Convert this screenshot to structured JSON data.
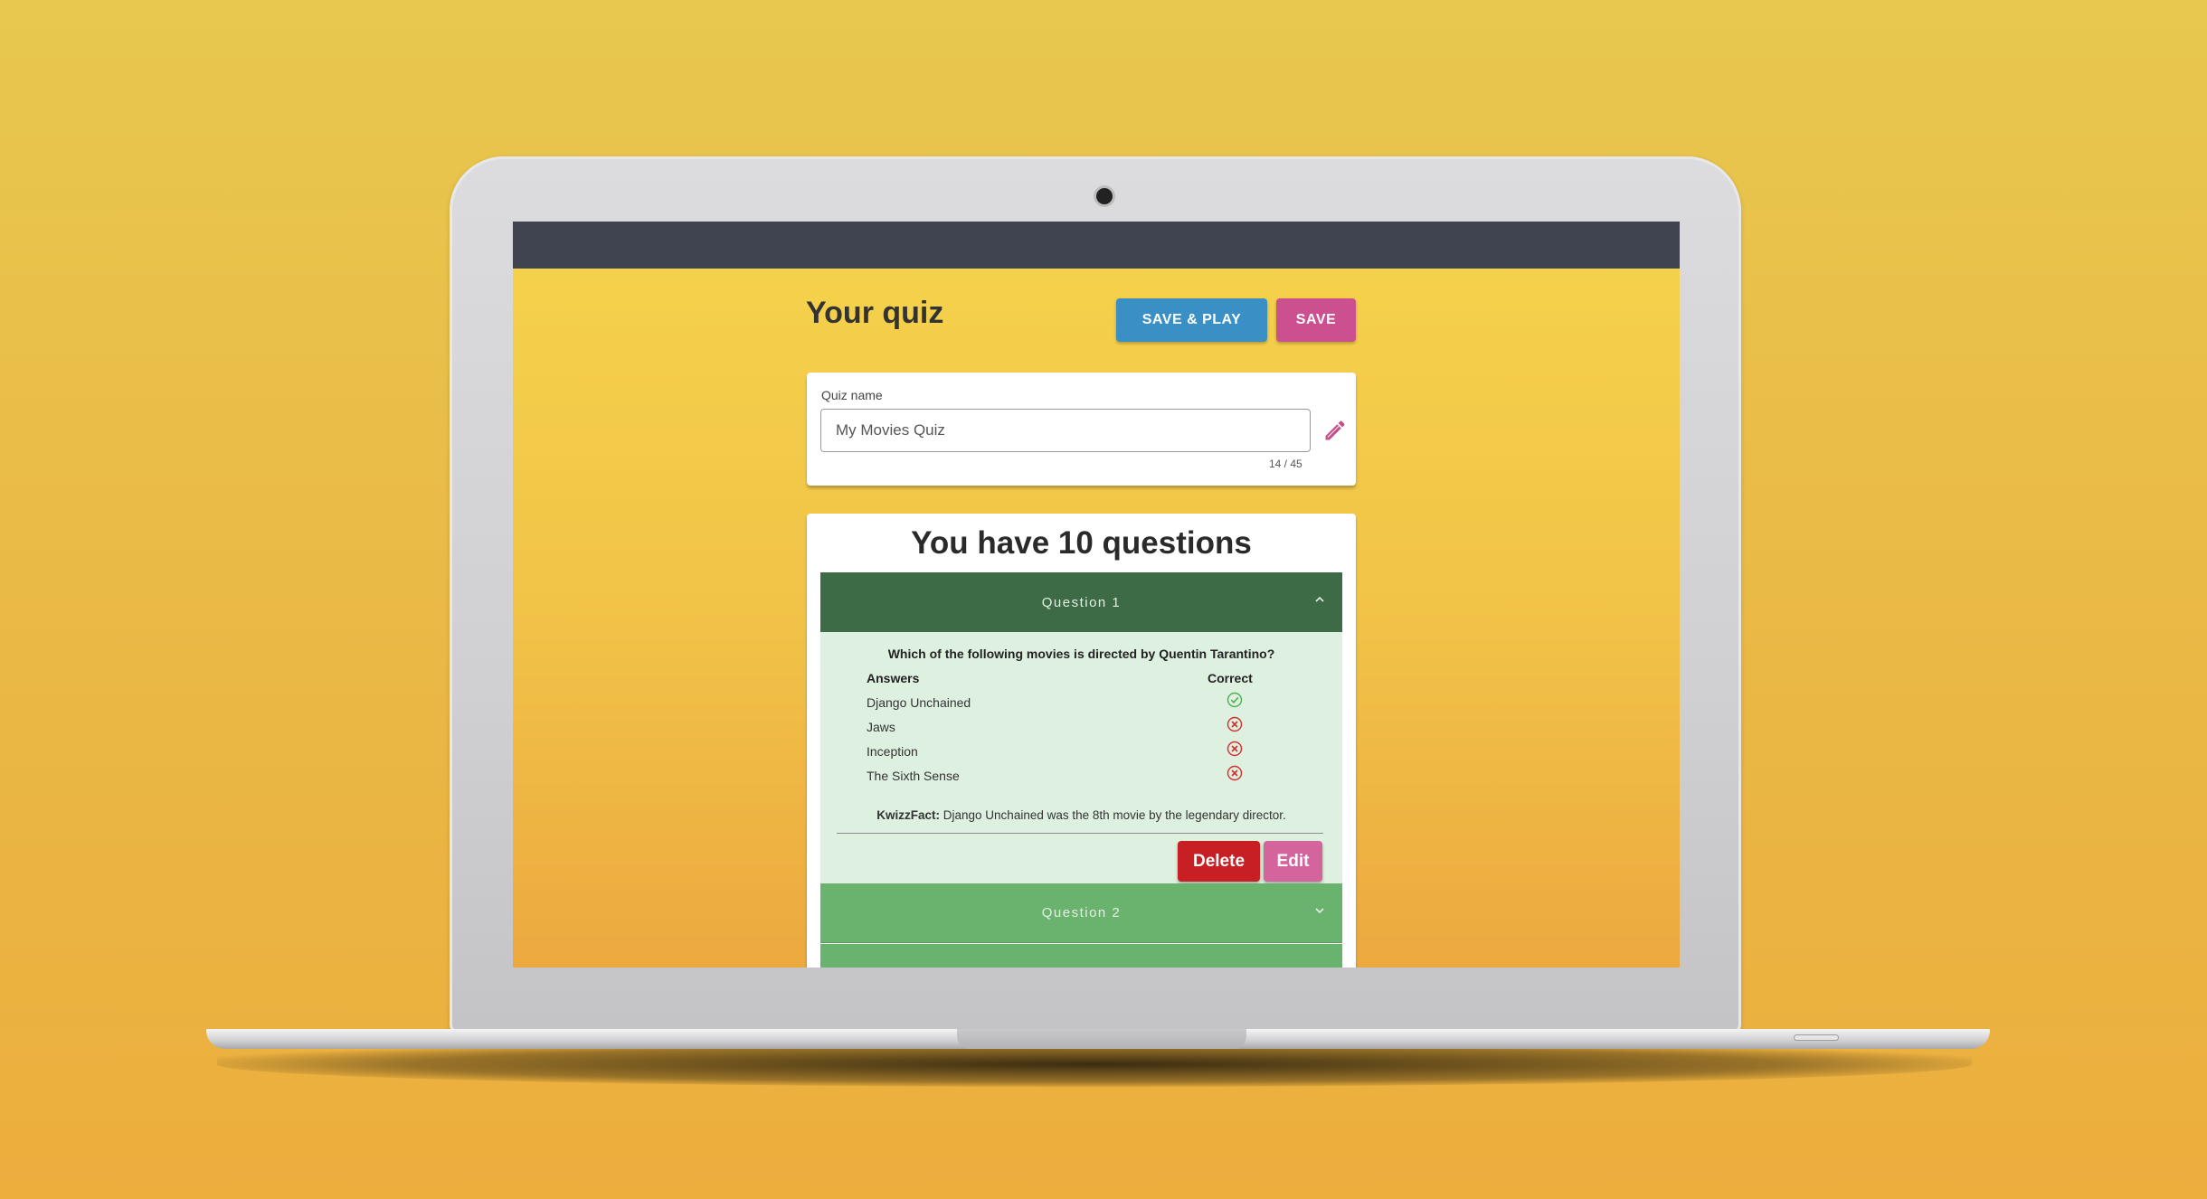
{
  "colors": {
    "background": "#eab845",
    "topbar": "#404450",
    "save_play": "#3a8fc4",
    "save": "#cc4f8f",
    "question_open_header": "#3c6b45",
    "question_closed_header": "#6ab36e",
    "question_body": "#def0df",
    "delete": "#c81f24",
    "edit": "#d4649c",
    "correct_mark": "#4caf50",
    "wrong_mark": "#d32f2f"
  },
  "header": {
    "title": "Your quiz",
    "save_play_label": "SAVE & PLAY",
    "save_label": "SAVE"
  },
  "quiz_name": {
    "label": "Quiz name",
    "value": "My Movies Quiz",
    "counter": "14 / 45",
    "edit_icon": "pencil-icon"
  },
  "questions": {
    "count_heading": "You have 10 questions",
    "items": [
      {
        "header": "Question 1",
        "expanded": true,
        "text": "Which of the following movies is directed by Quentin Tarantino?",
        "answers_heading": "Answers",
        "correct_heading": "Correct",
        "answers": [
          {
            "label": "Django Unchained",
            "correct": true
          },
          {
            "label": "Jaws",
            "correct": false
          },
          {
            "label": "Inception",
            "correct": false
          },
          {
            "label": "The Sixth Sense",
            "correct": false
          }
        ],
        "fact_label": "KwizzFact:",
        "fact_text": " Django Unchained was the 8th movie by the legendary director.",
        "delete_label": "Delete",
        "edit_label": "Edit"
      },
      {
        "header": "Question 2",
        "expanded": false
      }
    ]
  }
}
